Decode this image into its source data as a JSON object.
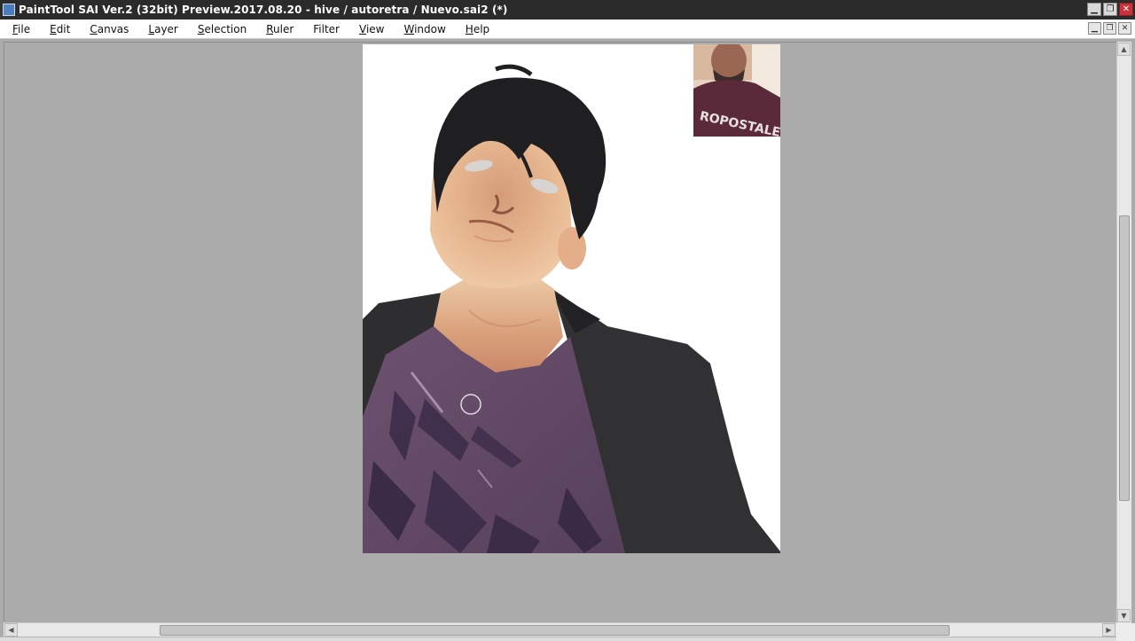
{
  "window": {
    "title": "PaintTool SAI Ver.2 (32bit) Preview.2017.08.20 - hive / autoretra / Nuevo.sai2 (*)",
    "controls": [
      "minimize",
      "restore",
      "close"
    ]
  },
  "menu": [
    {
      "label": "File",
      "accel": "F",
      "rest": "ile"
    },
    {
      "label": "Edit",
      "accel": "E",
      "rest": "dit"
    },
    {
      "label": "Canvas",
      "accel": "C",
      "rest": "anvas"
    },
    {
      "label": "Layer",
      "accel": "L",
      "rest": "ayer"
    },
    {
      "label": "Selection",
      "accel": "S",
      "rest": "election"
    },
    {
      "label": "Ruler",
      "accel": "R",
      "rest": "uler"
    },
    {
      "label": "Filter",
      "accel": "",
      "rest": "Filter"
    },
    {
      "label": "View",
      "accel": "V",
      "rest": "iew"
    },
    {
      "label": "Window",
      "accel": "W",
      "rest": "indow"
    },
    {
      "label": "Help",
      "accel": "H",
      "rest": "elp"
    }
  ],
  "canvas": {
    "artwork": "digital portrait painting",
    "webcam_text": "ROPOSTALE"
  },
  "colors": {
    "hair": "#1e1d1f",
    "skin": "#e2ad89",
    "shirt": "#5f4763",
    "jacket": "#2f2f31"
  }
}
